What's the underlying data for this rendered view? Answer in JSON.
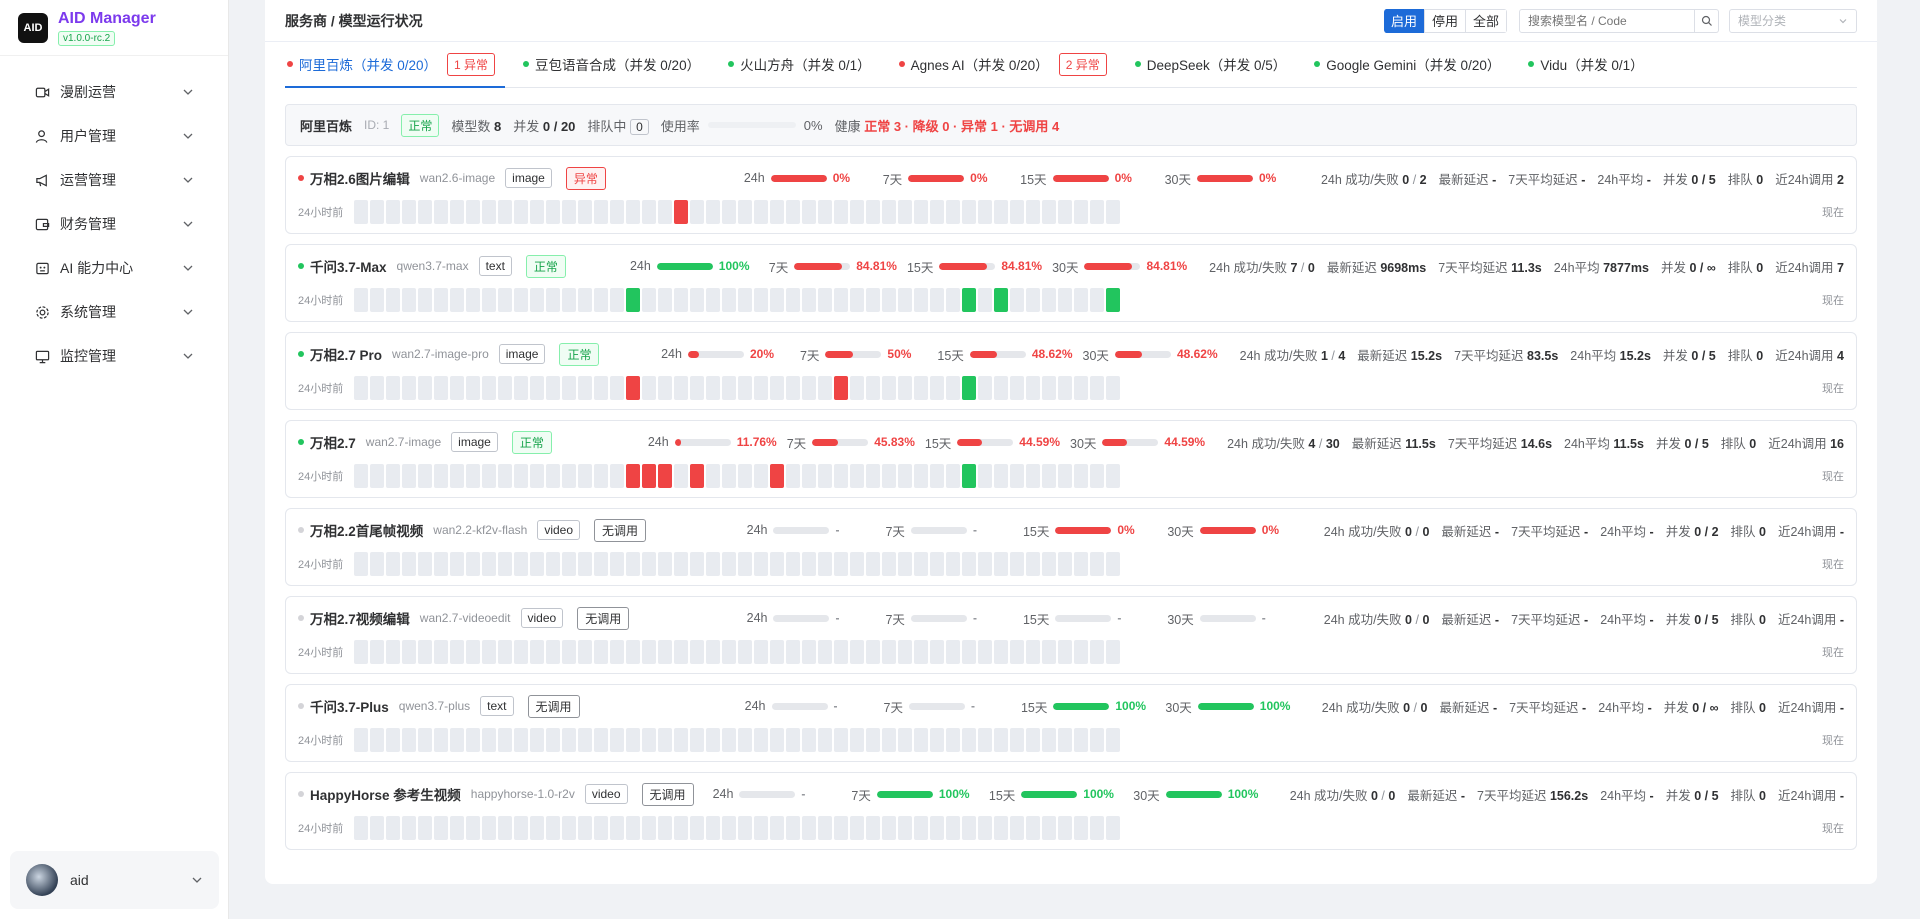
{
  "app": {
    "logo_mark": "AID",
    "title": "AID Manager",
    "version": "v1.0.0-rc.2"
  },
  "sidebar": {
    "items": [
      {
        "label": "漫剧运营",
        "icon": "video-icon"
      },
      {
        "label": "用户管理",
        "icon": "user-icon"
      },
      {
        "label": "运营管理",
        "icon": "megaphone-icon"
      },
      {
        "label": "财务管理",
        "icon": "wallet-icon"
      },
      {
        "label": "AI 能力中心",
        "icon": "robot-icon"
      },
      {
        "label": "系统管理",
        "icon": "gear-icon"
      },
      {
        "label": "监控管理",
        "icon": "monitor-icon"
      }
    ],
    "user": {
      "name": "aid"
    }
  },
  "header": {
    "title": "服务商 / 模型运行状况",
    "filter": {
      "enabled": "启用",
      "disabled": "停用",
      "all": "全部",
      "active": "启用"
    },
    "search_placeholder": "搜索模型名 / Code",
    "category_placeholder": "模型分类"
  },
  "tabs": [
    {
      "label": "阿里百炼（并发 0/20）",
      "status": "red",
      "badge": "1 异常",
      "active": true
    },
    {
      "label": "豆包语音合成（并发 0/20）",
      "status": "green"
    },
    {
      "label": "火山方舟（并发 0/1）",
      "status": "green"
    },
    {
      "label": "Agnes AI（并发 0/20）",
      "status": "red",
      "badge": "2 异常"
    },
    {
      "label": "DeepSeek（并发 0/5）",
      "status": "green"
    },
    {
      "label": "Google Gemini（并发 0/20）",
      "status": "green"
    },
    {
      "label": "Vidu（并发 0/1）",
      "status": "green"
    }
  ],
  "summary": {
    "name": "阿里百炼",
    "id": "ID: 1",
    "status": "正常",
    "model_count_label": "模型数",
    "model_count": "8",
    "concurrency_label": "并发",
    "concurrency": "0 / 20",
    "queue_label": "排队中",
    "queue": "0",
    "usage_label": "使用率",
    "usage_value": "0%",
    "health_label": "健康",
    "health_value": "正常 3 · 降级 0 · 异常 1 · 无调用 4"
  },
  "labels": {
    "hb_start": "24小时前",
    "hb_end": "现在",
    "success_fail": "24h 成功/失败",
    "latest_latency": "最新延迟",
    "avg7": "7天平均延迟",
    "avg24": "24h平均",
    "concurrency": "并发",
    "queue": "排队",
    "calls24": "近24h调用"
  },
  "models": [
    {
      "name": "万相2.6图片编辑",
      "code": "wan2.6-image",
      "type": "image",
      "status": "异常",
      "status_kind": "err",
      "dot": "red",
      "rates": [
        {
          "label": "24h",
          "value": "0%",
          "fill": 1.0,
          "color": "red"
        },
        {
          "label": "7天",
          "value": "0%",
          "fill": 1.0,
          "color": "red"
        },
        {
          "label": "15天",
          "value": "0%",
          "fill": 1.0,
          "color": "red"
        },
        {
          "label": "30天",
          "value": "0%",
          "fill": 1.0,
          "color": "red"
        }
      ],
      "success": "0",
      "fail": "2",
      "latest": "-",
      "avg7": "-",
      "avg24": "-",
      "concurrency": "0 / 5",
      "queue": "0",
      "calls": "2",
      "heartbeat": {
        "red": [
          20
        ],
        "green": []
      }
    },
    {
      "name": "千问3.7-Max",
      "code": "qwen3.7-max",
      "type": "text",
      "status": "正常",
      "status_kind": "ok",
      "dot": "green",
      "rates": [
        {
          "label": "24h",
          "value": "100%",
          "fill": 1.0,
          "color": "green"
        },
        {
          "label": "7天",
          "value": "84.81%",
          "fill": 0.8481,
          "color": "red"
        },
        {
          "label": "15天",
          "value": "84.81%",
          "fill": 0.8481,
          "color": "red"
        },
        {
          "label": "30天",
          "value": "84.81%",
          "fill": 0.8481,
          "color": "red"
        }
      ],
      "success": "7",
      "fail": "0",
      "latest": "9698ms",
      "avg7": "11.3s",
      "avg24": "7877ms",
      "concurrency": "0 / ∞",
      "queue": "0",
      "calls": "7",
      "heartbeat": {
        "red": [],
        "green": [
          17,
          38,
          40,
          47
        ]
      }
    },
    {
      "name": "万相2.7 Pro",
      "code": "wan2.7-image-pro",
      "type": "image",
      "status": "正常",
      "status_kind": "ok",
      "dot": "green",
      "rates": [
        {
          "label": "24h",
          "value": "20%",
          "fill": 0.2,
          "color": "red"
        },
        {
          "label": "7天",
          "value": "50%",
          "fill": 0.5,
          "color": "red"
        },
        {
          "label": "15天",
          "value": "48.62%",
          "fill": 0.4862,
          "color": "red"
        },
        {
          "label": "30天",
          "value": "48.62%",
          "fill": 0.4862,
          "color": "red"
        }
      ],
      "success": "1",
      "fail": "4",
      "latest": "15.2s",
      "avg7": "83.5s",
      "avg24": "15.2s",
      "concurrency": "0 / 5",
      "queue": "0",
      "calls": "4",
      "heartbeat": {
        "red": [
          17,
          30
        ],
        "green": [
          38
        ]
      }
    },
    {
      "name": "万相2.7",
      "code": "wan2.7-image",
      "type": "image",
      "status": "正常",
      "status_kind": "ok",
      "dot": "green",
      "rates": [
        {
          "label": "24h",
          "value": "11.76%",
          "fill": 0.1176,
          "color": "red"
        },
        {
          "label": "7天",
          "value": "45.83%",
          "fill": 0.4583,
          "color": "red"
        },
        {
          "label": "15天",
          "value": "44.59%",
          "fill": 0.4459,
          "color": "red"
        },
        {
          "label": "30天",
          "value": "44.59%",
          "fill": 0.4459,
          "color": "red"
        }
      ],
      "success": "4",
      "fail": "30",
      "latest": "11.5s",
      "avg7": "14.6s",
      "avg24": "11.5s",
      "concurrency": "0 / 5",
      "queue": "0",
      "calls": "16",
      "heartbeat": {
        "red": [
          17,
          18,
          19,
          21,
          26
        ],
        "green": [
          38
        ]
      }
    },
    {
      "name": "万相2.2首尾帧视频",
      "code": "wan2.2-kf2v-flash",
      "type": "video",
      "status": "无调用",
      "status_kind": "none",
      "dot": "gray",
      "rates": [
        {
          "label": "24h",
          "value": "-",
          "fill": 0,
          "color": "gray"
        },
        {
          "label": "7天",
          "value": "-",
          "fill": 0,
          "color": "gray"
        },
        {
          "label": "15天",
          "value": "0%",
          "fill": 1.0,
          "color": "red"
        },
        {
          "label": "30天",
          "value": "0%",
          "fill": 1.0,
          "color": "red"
        }
      ],
      "success": "0",
      "fail": "0",
      "latest": "-",
      "avg7": "-",
      "avg24": "-",
      "concurrency": "0 / 2",
      "queue": "0",
      "calls": "-",
      "heartbeat": {
        "red": [],
        "green": []
      }
    },
    {
      "name": "万相2.7视频编辑",
      "code": "wan2.7-videoedit",
      "type": "video",
      "status": "无调用",
      "status_kind": "none",
      "dot": "gray",
      "rates": [
        {
          "label": "24h",
          "value": "-",
          "fill": 0,
          "color": "gray"
        },
        {
          "label": "7天",
          "value": "-",
          "fill": 0,
          "color": "gray"
        },
        {
          "label": "15天",
          "value": "-",
          "fill": 0,
          "color": "gray"
        },
        {
          "label": "30天",
          "value": "-",
          "fill": 0,
          "color": "gray"
        }
      ],
      "success": "0",
      "fail": "0",
      "latest": "-",
      "avg7": "-",
      "avg24": "-",
      "concurrency": "0 / 5",
      "queue": "0",
      "calls": "-",
      "heartbeat": {
        "red": [],
        "green": []
      }
    },
    {
      "name": "千问3.7-Plus",
      "code": "qwen3.7-plus",
      "type": "text",
      "status": "无调用",
      "status_kind": "none",
      "dot": "gray",
      "rates": [
        {
          "label": "24h",
          "value": "-",
          "fill": 0,
          "color": "gray"
        },
        {
          "label": "7天",
          "value": "-",
          "fill": 0,
          "color": "gray"
        },
        {
          "label": "15天",
          "value": "100%",
          "fill": 1.0,
          "color": "green"
        },
        {
          "label": "30天",
          "value": "100%",
          "fill": 1.0,
          "color": "green"
        }
      ],
      "success": "0",
      "fail": "0",
      "latest": "-",
      "avg7": "-",
      "avg24": "-",
      "concurrency": "0 / ∞",
      "queue": "0",
      "calls": "-",
      "heartbeat": {
        "red": [],
        "green": []
      }
    },
    {
      "name": "HappyHorse 参考生视频",
      "code": "happyhorse-1.0-r2v",
      "type": "video",
      "status": "无调用",
      "status_kind": "none",
      "dot": "gray",
      "rates": [
        {
          "label": "24h",
          "value": "-",
          "fill": 0,
          "color": "gray"
        },
        {
          "label": "7天",
          "value": "100%",
          "fill": 1.0,
          "color": "green"
        },
        {
          "label": "15天",
          "value": "100%",
          "fill": 1.0,
          "color": "green"
        },
        {
          "label": "30天",
          "value": "100%",
          "fill": 1.0,
          "color": "green"
        }
      ],
      "success": "0",
      "fail": "0",
      "latest": "-",
      "avg7": "156.2s",
      "avg24": "-",
      "concurrency": "0 / 5",
      "queue": "0",
      "calls": "-",
      "heartbeat": {
        "red": [],
        "green": []
      }
    }
  ],
  "colors": {
    "primary": "#1d6bd8",
    "red": "#ef4444",
    "green": "#22c55e",
    "brand": "#7c3aed"
  }
}
